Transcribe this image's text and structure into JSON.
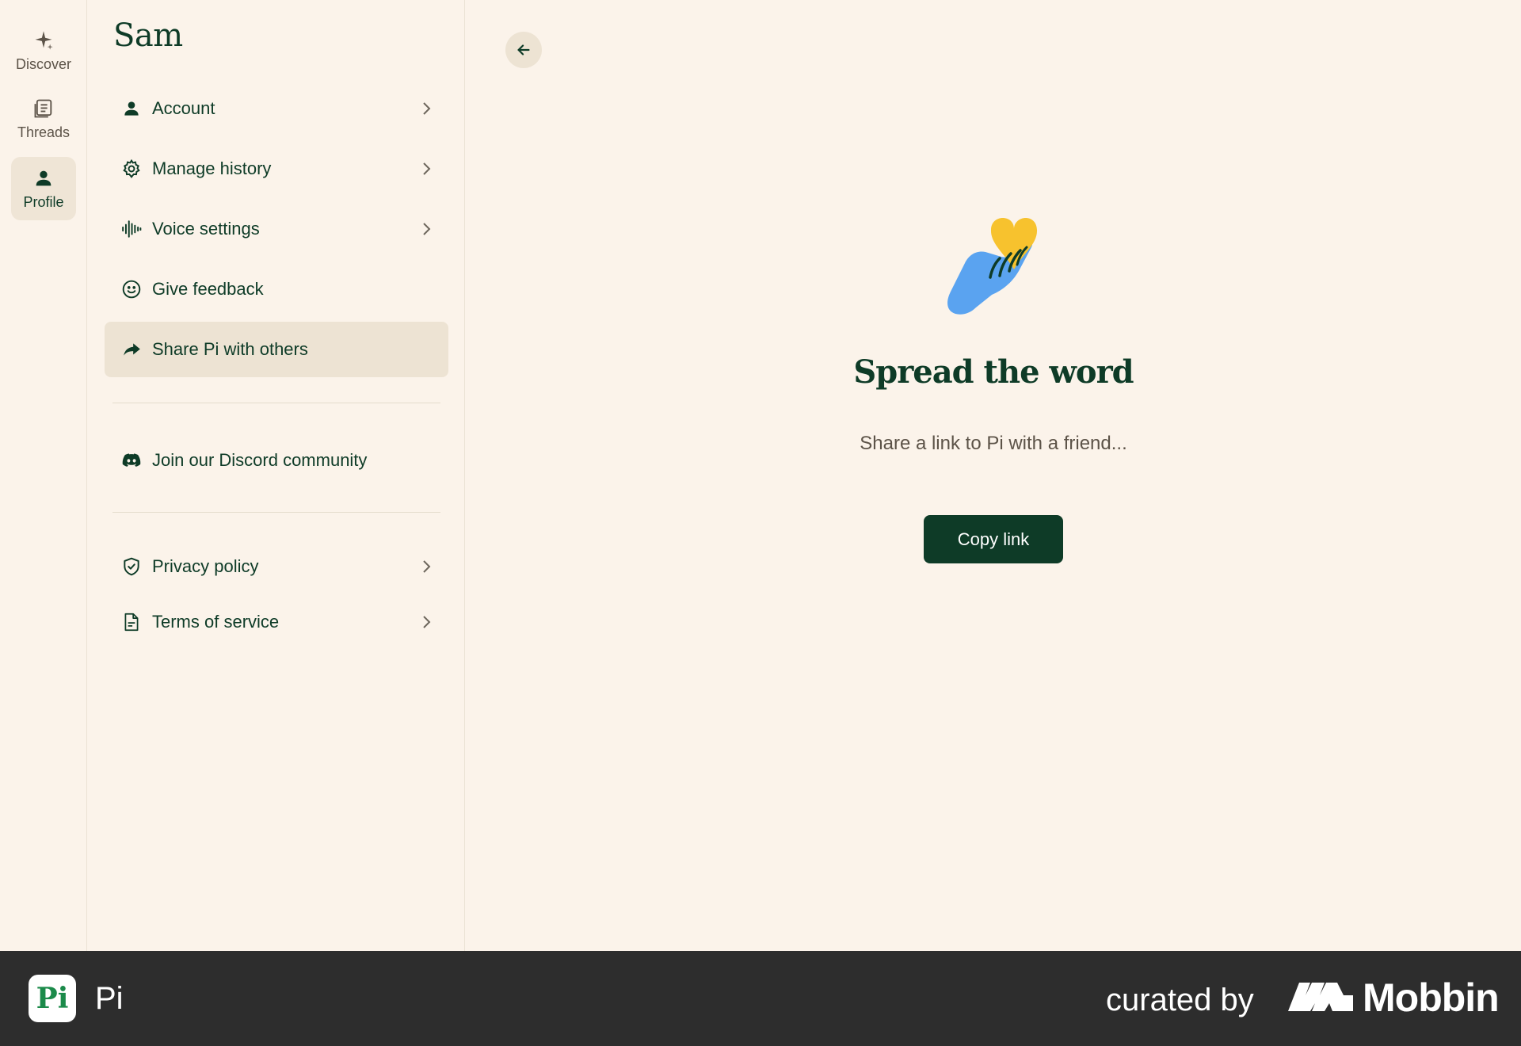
{
  "rail": {
    "items": [
      {
        "label": "Discover",
        "icon": "sparkle-icon"
      },
      {
        "label": "Threads",
        "icon": "threads-icon"
      },
      {
        "label": "Profile",
        "icon": "person-icon",
        "active": true
      }
    ]
  },
  "profile": {
    "name": "Sam",
    "menu": [
      {
        "label": "Account",
        "icon": "person-icon",
        "chevron": true
      },
      {
        "label": "Manage history",
        "icon": "gear-icon",
        "chevron": true
      },
      {
        "label": "Voice settings",
        "icon": "waveform-icon",
        "chevron": true
      },
      {
        "label": "Give feedback",
        "icon": "smiley-icon",
        "chevron": false
      },
      {
        "label": "Share Pi with others",
        "icon": "share-arrow-icon",
        "chevron": false,
        "active": true
      },
      {
        "label": "Join our Discord community",
        "icon": "discord-icon",
        "chevron": false
      },
      {
        "label": "Privacy policy",
        "icon": "shield-check-icon",
        "chevron": true
      },
      {
        "label": "Terms of service",
        "icon": "document-icon",
        "chevron": true
      }
    ]
  },
  "main": {
    "back_icon": "arrow-left-icon",
    "illustration": "hand-holding-heart-icon",
    "headline": "Spread the word",
    "subtext": "Share a link to Pi with a friend...",
    "copy_button": "Copy link"
  },
  "footer": {
    "app_logo": "Pi",
    "app_name": "Pi",
    "curated_by": "curated by",
    "brand": "Mobbin"
  },
  "colors": {
    "background": "#fbf3ea",
    "primary": "#0e3b27",
    "active_bg": "#ede3d3",
    "footer_bg": "#2d2d2d",
    "heart": "#f7c22e",
    "hand": "#5aa3f0"
  }
}
